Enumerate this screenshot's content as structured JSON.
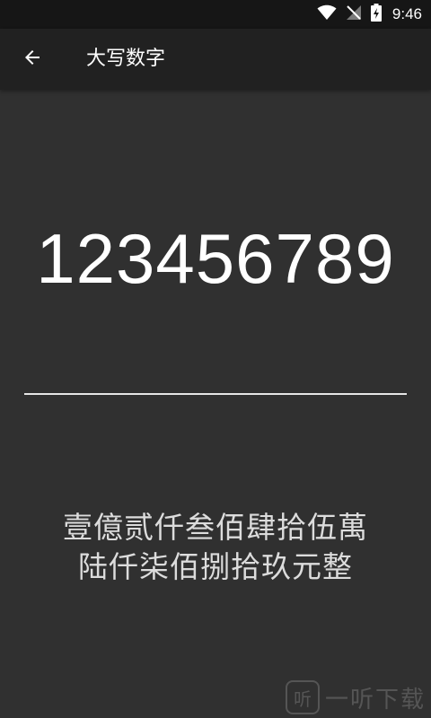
{
  "status_bar": {
    "time": "9:46",
    "icons": [
      "wifi-icon",
      "no-signal-icon",
      "battery-charging-icon"
    ]
  },
  "app_bar": {
    "back_icon": "arrow-left-icon",
    "title": "大写数字"
  },
  "main": {
    "number_input": "123456789",
    "result_line_1": "壹億贰仟叁佰肆拾伍萬",
    "result_line_2": "陆仟柒佰捌拾玖元整"
  },
  "watermark": {
    "logo_char": "听",
    "text": "一听下载"
  },
  "colors": {
    "background": "#303030",
    "app_bar": "#212121",
    "status_bar": "#161616",
    "text": "#ffffff",
    "result_text": "#dcdcdc"
  }
}
